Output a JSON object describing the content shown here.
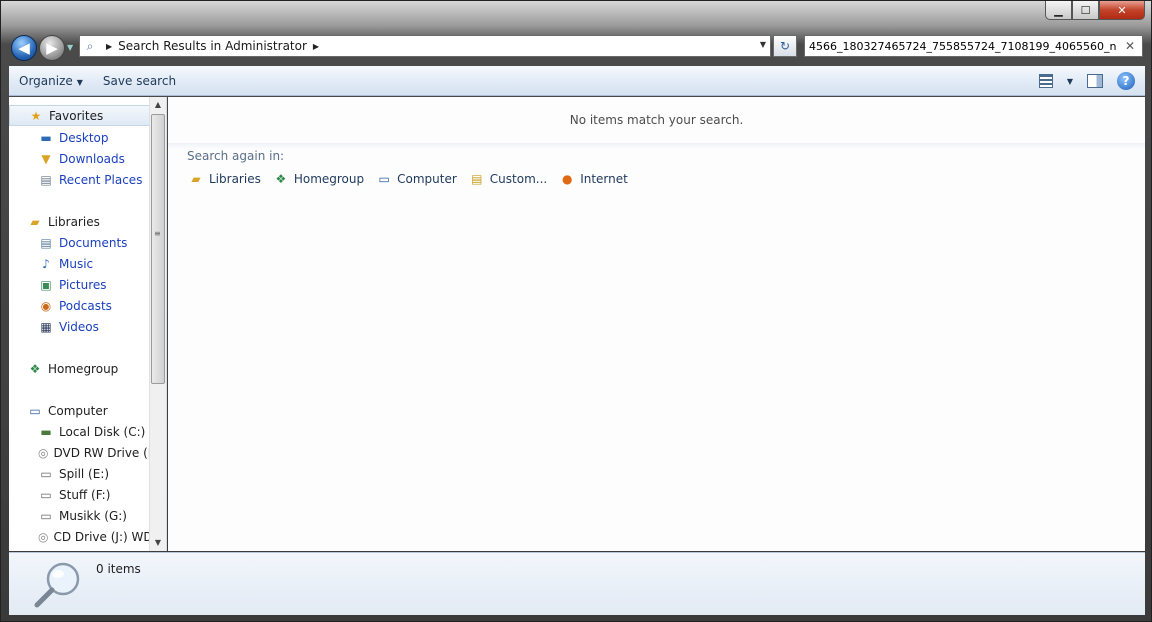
{
  "window": {
    "minimize": "▁",
    "maximize": "☐",
    "close": "✕"
  },
  "nav": {
    "back_glyph": "◀",
    "forward_glyph": "▶",
    "address": {
      "crumbs": [
        "Search Results in Administrator"
      ]
    },
    "refresh_glyph": "↻",
    "search": {
      "value": "4566_180327465724_755855724_7108199_4065560_n",
      "clear_glyph": "✕"
    }
  },
  "toolbar": {
    "organize_label": "Organize",
    "save_search_label": "Save search",
    "help_glyph": "?"
  },
  "sidebar": {
    "favorites": {
      "label": "Favorites",
      "items": [
        {
          "label": "Desktop",
          "icon": "desktop-icon"
        },
        {
          "label": "Downloads",
          "icon": "downloads-icon"
        },
        {
          "label": "Recent Places",
          "icon": "recent-places-icon"
        }
      ]
    },
    "libraries": {
      "label": "Libraries",
      "items": [
        {
          "label": "Documents",
          "icon": "documents-icon"
        },
        {
          "label": "Music",
          "icon": "music-icon"
        },
        {
          "label": "Pictures",
          "icon": "pictures-icon"
        },
        {
          "label": "Podcasts",
          "icon": "podcasts-icon"
        },
        {
          "label": "Videos",
          "icon": "videos-icon"
        }
      ]
    },
    "homegroup": {
      "label": "Homegroup"
    },
    "computer": {
      "label": "Computer",
      "items": [
        {
          "label": "Local Disk (C:)",
          "icon": "local-disk-icon"
        },
        {
          "label": "DVD RW Drive (D",
          "icon": "dvd-drive-icon"
        },
        {
          "label": "Spill (E:)",
          "icon": "drive-icon"
        },
        {
          "label": "Stuff (F:)",
          "icon": "drive-icon"
        },
        {
          "label": "Musikk (G:)",
          "icon": "drive-icon"
        },
        {
          "label": "CD Drive (J:) WD",
          "icon": "cd-drive-icon"
        }
      ]
    }
  },
  "main": {
    "empty_message": "No items match your search.",
    "search_again_label": "Search again in:",
    "search_again": [
      {
        "label": "Libraries",
        "icon": "libraries-icon"
      },
      {
        "label": "Homegroup",
        "icon": "homegroup-icon"
      },
      {
        "label": "Computer",
        "icon": "computer-icon"
      },
      {
        "label": "Custom...",
        "icon": "custom-folder-icon"
      },
      {
        "label": "Internet",
        "icon": "firefox-icon"
      }
    ]
  },
  "status": {
    "count": "0 items"
  },
  "colors": {
    "link": "#1a3fbf",
    "toolbar_text": "#1e395b",
    "accent": "#2868b8"
  }
}
